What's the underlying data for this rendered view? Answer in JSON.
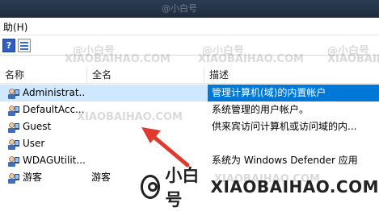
{
  "menubar": {
    "help_label": "助(H)"
  },
  "columns": {
    "name": "名称",
    "full_name": "全名",
    "description": "描述"
  },
  "rows": [
    {
      "name": "Administrat...",
      "full_name": "",
      "description": "管理计算机(域)的内置帐户",
      "selected": true
    },
    {
      "name": "DefaultAcc...",
      "full_name": "",
      "description": "系统管理的用户帐户。",
      "selected": false
    },
    {
      "name": "Guest",
      "full_name": "",
      "description": "供来宾访问计算机或访问域的内...",
      "selected": false
    },
    {
      "name": "User",
      "full_name": "",
      "description": "",
      "selected": false
    },
    {
      "name": "WDAGUtilit...",
      "full_name": "",
      "description": "系统为 Windows Defender 应用",
      "selected": false
    },
    {
      "name": "游客",
      "full_name": "游客",
      "description": "",
      "selected": false
    }
  ],
  "watermarks": {
    "top": "@小白号",
    "xiao": "XIAOBAIHAO.COM"
  },
  "brand": {
    "cn": "小白号",
    "en": "XIAOBAIHAO.COM"
  },
  "colors": {
    "selected_row": "#cde8ff",
    "selected_desc": "#0078d7",
    "arrow": "#e03a2f"
  },
  "icons": [
    "help-icon",
    "properties-icon",
    "user-icon"
  ]
}
